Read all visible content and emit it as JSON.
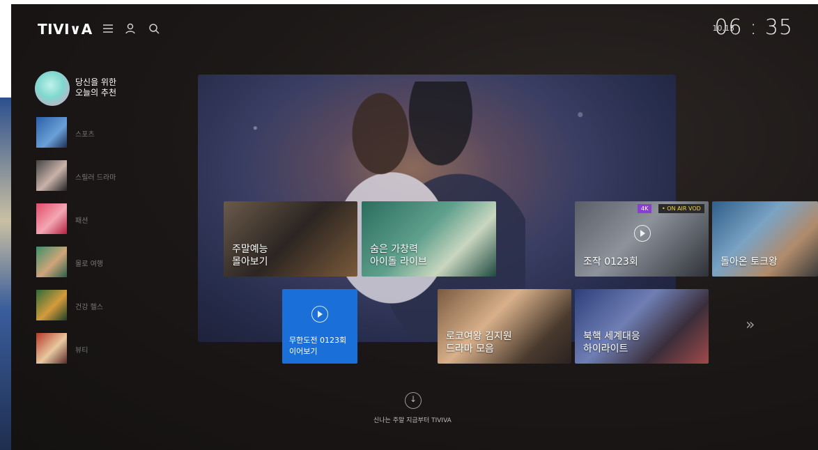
{
  "header": {
    "logo": "TIVI∨A",
    "date": "10.13",
    "time": "06 : 35",
    "icons": [
      "menu-icon",
      "profile-icon",
      "search-icon"
    ]
  },
  "sidebar": {
    "recommendation_label": "당신을 위한\n오늘의 추천",
    "items": [
      {
        "label": "스포츠"
      },
      {
        "label": "스릴러 드라마"
      },
      {
        "label": "패션"
      },
      {
        "label": "몰로 여행"
      },
      {
        "label": "건강 헬스"
      },
      {
        "label": "뷰티"
      }
    ]
  },
  "cards": [
    {
      "label": "주말예능\n몰아보기"
    },
    {
      "label": "숨은 가창력\n아이돌 라이브"
    },
    {
      "label": "조작 0123회",
      "badge_4k": "4K",
      "badge_onair": "• ON AIR VOD"
    },
    {
      "label": "돌아온 토크왕"
    },
    {
      "label": "로코여왕 김지원\n드라마 모음"
    },
    {
      "label": "북핵 세계대응\n하이라이트"
    }
  ],
  "continue": {
    "label": "무한도전   0123회\n이어보기"
  },
  "footer": {
    "text": "신나는 주말 지금부터 TIVIVA"
  },
  "colors": {
    "accent_blue": "#1a6fd8",
    "badge_4k": "#8a3fd1",
    "badge_onair_text": "#f1d34b"
  }
}
